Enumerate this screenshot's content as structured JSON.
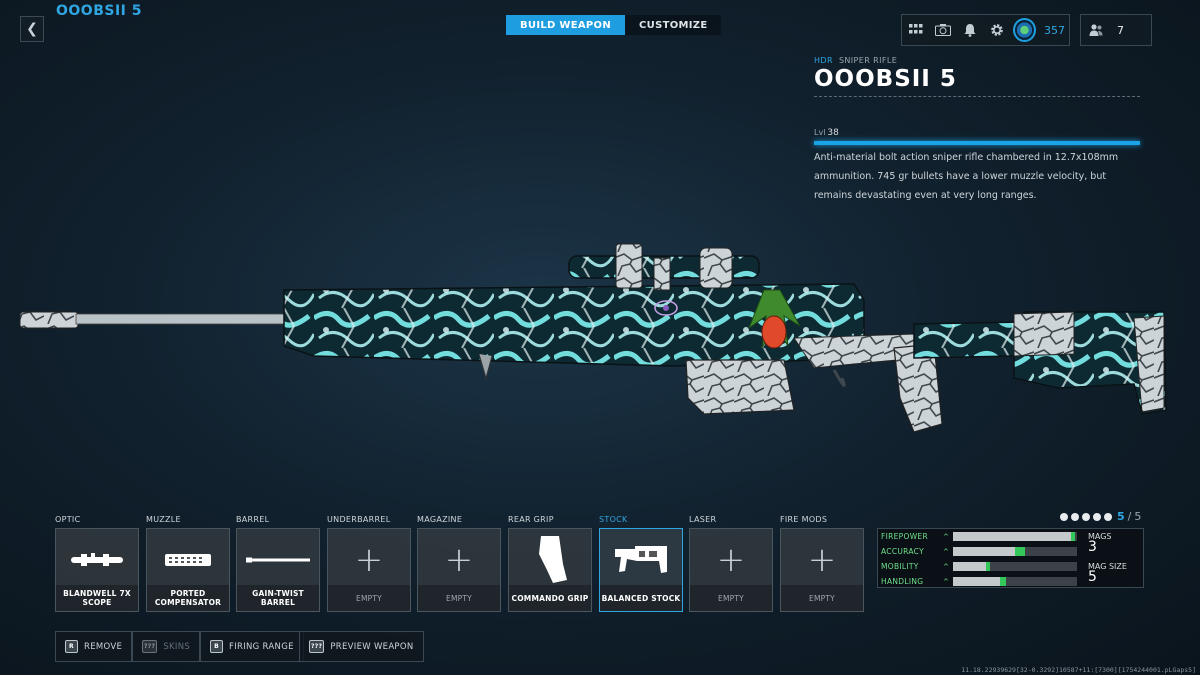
{
  "header": {
    "back_label": "❮",
    "loadout_name": "OOOBSII 5",
    "tabs": [
      {
        "label": "BUILD WEAPON",
        "active": true
      },
      {
        "label": "CUSTOMIZE",
        "active": false
      }
    ],
    "icons": [
      "grid-menu-icon",
      "camera-icon",
      "bell-icon",
      "gear-icon",
      "prestige-icon"
    ],
    "tokens": "357",
    "party_count": "7"
  },
  "weapon": {
    "brand": "HDR",
    "class": "SNIPER RIFLE",
    "name": "OOOBSII 5",
    "level_label": "Lvl",
    "level": "38",
    "description": "Anti-material bolt action sniper rifle chambered in 12.7x108mm ammunition. 745 gr bullets have a lower muzzle velocity, but remains devastating even at very long ranges.",
    "camo_colors": [
      "#7ff0f0",
      "#c9d2d6",
      "#0b1a22"
    ]
  },
  "attachments": [
    {
      "category": "OPTIC",
      "name": "BLANDWELL 7X SCOPE",
      "equipped": true,
      "selected": false,
      "icon": "scope-icon"
    },
    {
      "category": "MUZZLE",
      "name": "PORTED COMPENSATOR",
      "equipped": true,
      "selected": false,
      "icon": "compensator-icon"
    },
    {
      "category": "BARREL",
      "name": "GAIN-TWIST BARREL",
      "equipped": true,
      "selected": false,
      "icon": "barrel-icon"
    },
    {
      "category": "UNDERBARREL",
      "name": "EMPTY",
      "equipped": false,
      "selected": false,
      "icon": "plus-icon"
    },
    {
      "category": "MAGAZINE",
      "name": "EMPTY",
      "equipped": false,
      "selected": false,
      "icon": "plus-icon"
    },
    {
      "category": "REAR GRIP",
      "name": "COMMANDO GRIP",
      "equipped": true,
      "selected": false,
      "icon": "grip-icon"
    },
    {
      "category": "STOCK",
      "name": "BALANCED STOCK",
      "equipped": true,
      "selected": true,
      "icon": "stock-icon"
    },
    {
      "category": "LASER",
      "name": "EMPTY",
      "equipped": false,
      "selected": false,
      "icon": "plus-icon"
    },
    {
      "category": "FIRE MODS",
      "name": "EMPTY",
      "equipped": false,
      "selected": false,
      "icon": "plus-icon"
    }
  ],
  "pager": {
    "current": "5",
    "separator": "/",
    "total": "5",
    "dots": 5
  },
  "stats": [
    {
      "name": "FIREPOWER",
      "base": 0.95,
      "bonus": 0.03
    },
    {
      "name": "ACCURACY",
      "base": 0.5,
      "bonus": 0.08
    },
    {
      "name": "MOBILITY",
      "base": 0.27,
      "bonus": 0.03
    },
    {
      "name": "HANDLING",
      "base": 0.38,
      "bonus": 0.05
    }
  ],
  "mag_info": {
    "mags_label": "MAGS",
    "mags_value": "3",
    "size_label": "MAG SIZE",
    "size_value": "5"
  },
  "buttons": [
    {
      "key": "R",
      "label": "REMOVE",
      "disabled": false
    },
    {
      "key": "???",
      "label": "SKINS",
      "disabled": true
    },
    {
      "key": "B",
      "label": "FIRING RANGE",
      "disabled": false
    },
    {
      "key": "???",
      "label": "PREVIEW WEAPON",
      "disabled": false
    }
  ],
  "build_id": "11.18.22939629[32-0.3292]10587+11:[7300][1754244001.pLGaps5]"
}
